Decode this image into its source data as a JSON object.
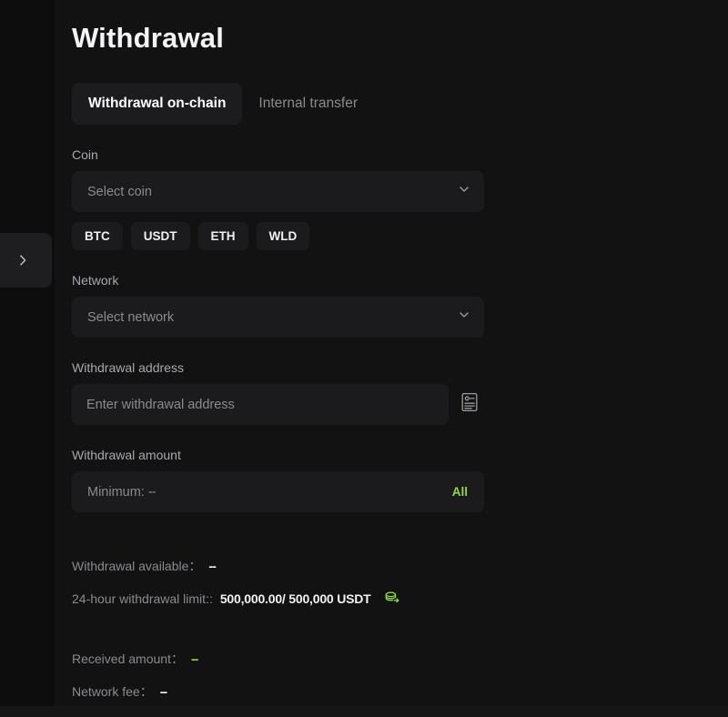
{
  "page": {
    "title": "Withdrawal",
    "background_color": "#0d0d0e",
    "panel_color": "#121213",
    "accent_green": "#8ede3a"
  },
  "sidebar": {
    "toggle_icon": "chevron-right-icon"
  },
  "tabs": [
    {
      "label": "Withdrawal on-chain",
      "active": true
    },
    {
      "label": "Internal transfer",
      "active": false
    }
  ],
  "coin": {
    "label": "Coin",
    "placeholder": "Select coin",
    "value": "",
    "chevron_icon": "chevron-down-icon",
    "quick_options": [
      "BTC",
      "USDT",
      "ETH",
      "WLD"
    ]
  },
  "network": {
    "label": "Network",
    "placeholder": "Select network",
    "value": "",
    "chevron_icon": "chevron-down-icon"
  },
  "address": {
    "label": "Withdrawal address",
    "placeholder": "Enter withdrawal address",
    "value": "",
    "book_icon": "address-book-icon"
  },
  "amount": {
    "label": "Withdrawal amount",
    "placeholder": "Minimum:  --",
    "minimum_label": "Minimum:",
    "minimum_value": "--",
    "value": "",
    "all_label": "All"
  },
  "info": {
    "available": {
      "key": "Withdrawal available：",
      "value": "--"
    },
    "limit": {
      "key": "24-hour withdrawal limit::",
      "value": "500,000.00/ 500,000 USDT",
      "icon": "coin-stack-icon"
    },
    "received": {
      "key": "Received amount：",
      "value": "--"
    },
    "network_fee": {
      "key": "Network fee：",
      "value": "--"
    }
  }
}
